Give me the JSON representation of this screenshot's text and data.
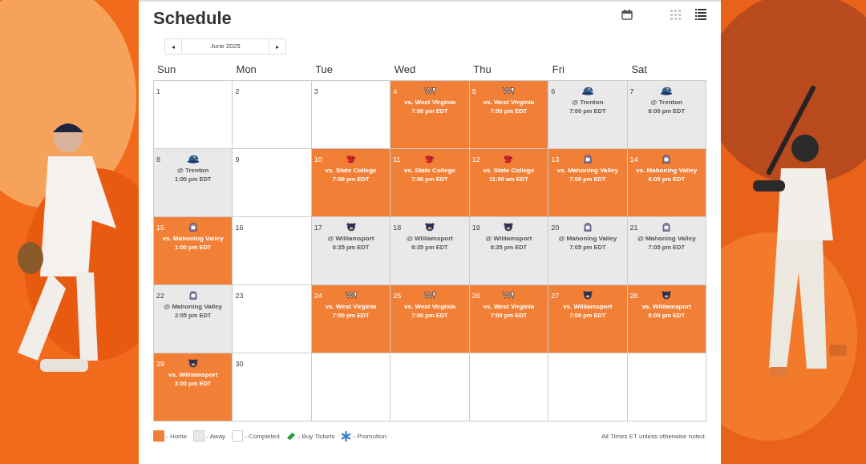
{
  "title": "Schedule",
  "month_nav": {
    "prev": "◂",
    "label": "June 2025",
    "next": "▸"
  },
  "view_buttons": [
    {
      "kind": "grid",
      "selected": false
    },
    {
      "kind": "list",
      "selected": true
    }
  ],
  "weekdays": [
    "Sun",
    "Mon",
    "Tue",
    "Wed",
    "Thu",
    "Fri",
    "Sat"
  ],
  "days": [
    {
      "day": "1",
      "kind": "completed"
    },
    {
      "day": "2",
      "kind": "completed"
    },
    {
      "day": "3",
      "kind": "completed"
    },
    {
      "day": "4",
      "kind": "home",
      "logo": {
        "kind": "monogram"
      },
      "opponent": "vs. West Virginia",
      "time": "7:00 pm EDT"
    },
    {
      "day": "5",
      "kind": "home",
      "logo": {
        "kind": "monogram"
      },
      "opponent": "vs. West Virginia",
      "time": "7:00 pm EDT"
    },
    {
      "day": "6",
      "kind": "away",
      "logo": {
        "kind": "cap"
      },
      "opponent": "@ Trenton",
      "time": "7:00 pm EDT"
    },
    {
      "day": "7",
      "kind": "away",
      "logo": {
        "kind": "cap"
      },
      "opponent": "@ Trenton",
      "time": "6:00 pm EDT"
    },
    {
      "day": "8",
      "kind": "away",
      "logo": {
        "kind": "cap"
      },
      "opponent": "@ Trenton",
      "time": "1:00 pm EDT"
    },
    {
      "day": "9",
      "kind": "completed"
    },
    {
      "day": "10",
      "kind": "home",
      "logo": {
        "kind": "bird"
      },
      "opponent": "vs. State College",
      "time": "7:00 pm EDT"
    },
    {
      "day": "11",
      "kind": "home",
      "logo": {
        "kind": "bird"
      },
      "opponent": "vs. State College",
      "time": "7:00 pm EDT"
    },
    {
      "day": "12",
      "kind": "home",
      "logo": {
        "kind": "bird"
      },
      "opponent": "vs. State College",
      "time": "11:00 am EDT"
    },
    {
      "day": "13",
      "kind": "home",
      "logo": {
        "kind": "knight"
      },
      "opponent": "vs. Mahoning Valley",
      "time": "7:00 pm EDT"
    },
    {
      "day": "14",
      "kind": "home",
      "logo": {
        "kind": "knight"
      },
      "opponent": "vs. Mahoning Valley",
      "time": "6:00 pm EDT"
    },
    {
      "day": "15",
      "kind": "home",
      "logo": {
        "kind": "knight"
      },
      "opponent": "vs. Mahoning Valley",
      "time": "1:00 pm EDT"
    },
    {
      "day": "16",
      "kind": "completed"
    },
    {
      "day": "17",
      "kind": "away",
      "logo": {
        "kind": "bear"
      },
      "opponent": "@ Williamsport",
      "time": "6:35 pm EDT"
    },
    {
      "day": "18",
      "kind": "away",
      "logo": {
        "kind": "bear"
      },
      "opponent": "@ Williamsport",
      "time": "6:35 pm EDT"
    },
    {
      "day": "19",
      "kind": "away",
      "logo": {
        "kind": "bear"
      },
      "opponent": "@ Williamsport",
      "time": "6:35 pm EDT"
    },
    {
      "day": "20",
      "kind": "away",
      "logo": {
        "kind": "knight"
      },
      "opponent": "@ Mahoning Valley",
      "time": "7:05 pm EDT"
    },
    {
      "day": "21",
      "kind": "away",
      "logo": {
        "kind": "knight"
      },
      "opponent": "@ Mahoning Valley",
      "time": "7:05 pm EDT"
    },
    {
      "day": "22",
      "kind": "away",
      "logo": {
        "kind": "knight"
      },
      "opponent": "@ Mahoning Valley",
      "time": "2:05 pm EDT"
    },
    {
      "day": "23",
      "kind": "completed"
    },
    {
      "day": "24",
      "kind": "home",
      "logo": {
        "kind": "monogram"
      },
      "opponent": "vs. West Virginia",
      "time": "7:00 pm EDT"
    },
    {
      "day": "25",
      "kind": "home",
      "logo": {
        "kind": "monogram"
      },
      "opponent": "vs. West Virginia",
      "time": "7:00 pm EDT"
    },
    {
      "day": "26",
      "kind": "home",
      "logo": {
        "kind": "monogram"
      },
      "opponent": "vs. West Virginia",
      "time": "7:00 pm EDT"
    },
    {
      "day": "27",
      "kind": "home",
      "logo": {
        "kind": "bear"
      },
      "opponent": "vs. Williamsport",
      "time": "7:00 pm EDT"
    },
    {
      "day": "28",
      "kind": "home",
      "logo": {
        "kind": "bear"
      },
      "opponent": "vs. Williamsport",
      "time": "6:00 pm EDT"
    },
    {
      "day": "29",
      "kind": "home",
      "logo": {
        "kind": "bear"
      },
      "opponent": "vs. Williamsport",
      "time": "3:00 pm EDT"
    },
    {
      "day": "30",
      "kind": "completed"
    },
    {
      "kind": "blank"
    },
    {
      "kind": "blank"
    },
    {
      "kind": "blank"
    },
    {
      "kind": "blank"
    },
    {
      "kind": "blank"
    }
  ],
  "legend": [
    {
      "kind": "home",
      "label": "- Home"
    },
    {
      "kind": "away",
      "label": "- Away"
    },
    {
      "kind": "completed",
      "label": "- Completed"
    },
    {
      "kind": "tickets",
      "label": "- Buy Tickets"
    },
    {
      "kind": "promotion",
      "label": "- Promotion"
    }
  ],
  "note": "All Times ET unless otherwise noted."
}
